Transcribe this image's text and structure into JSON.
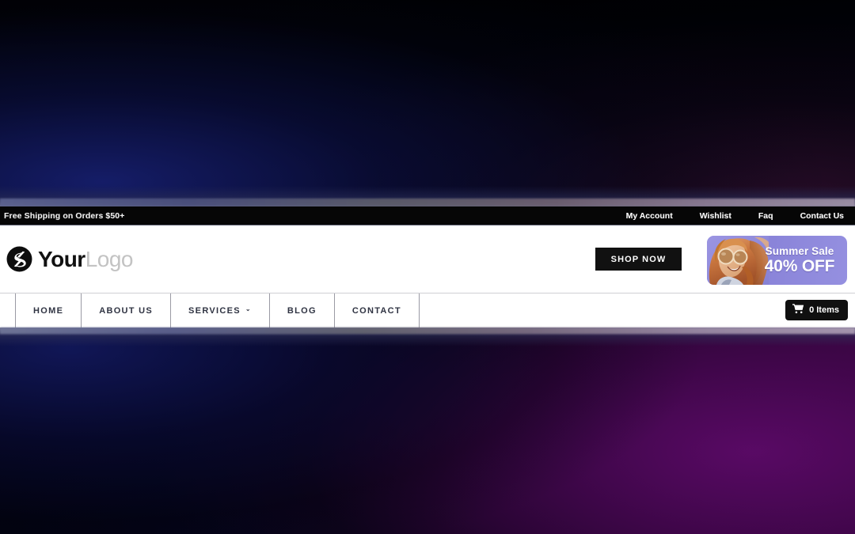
{
  "topbar": {
    "promo_text": "Free Shipping on Orders $50+",
    "links": [
      {
        "label": "My Account"
      },
      {
        "label": "Wishlist"
      },
      {
        "label": "Faq"
      },
      {
        "label": "Contact Us"
      }
    ]
  },
  "header": {
    "logo": {
      "icon": "swoosh-circle-logo-icon",
      "text_primary": "Your",
      "text_secondary": "Logo"
    },
    "shop_now_label": "SHOP NOW",
    "promo_banner": {
      "image_alt": "woman-with-sunglasses-photo",
      "title": "Summer Sale",
      "subtitle": "40% OFF",
      "background_color": "#8d87da"
    }
  },
  "nav": {
    "items": [
      {
        "label": "HOME",
        "has_dropdown": false
      },
      {
        "label": "ABOUT US",
        "has_dropdown": false
      },
      {
        "label": "SERVICES",
        "has_dropdown": true,
        "caret": "⌄"
      },
      {
        "label": "BLOG",
        "has_dropdown": false
      },
      {
        "label": "CONTACT",
        "has_dropdown": false
      }
    ],
    "cart": {
      "icon": "shopping-cart-icon",
      "label": "0 Items"
    }
  },
  "theme": {
    "topbar_bg": "#060606",
    "header_bg": "#ffffff",
    "nav_text": "#2f3342",
    "accent_dark": "#111111",
    "promo_purple": "#8d87da"
  }
}
